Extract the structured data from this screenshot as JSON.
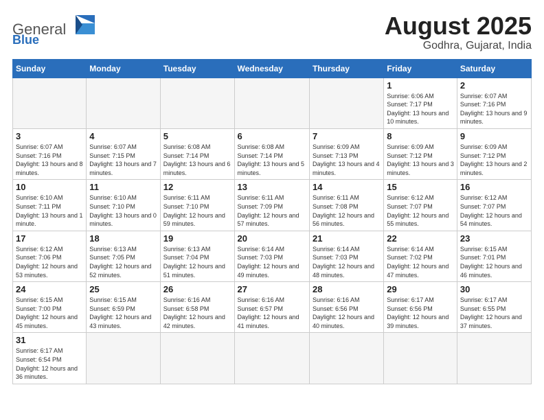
{
  "header": {
    "logo_text_general": "General",
    "logo_text_blue": "Blue",
    "month_year": "August 2025",
    "location": "Godhra, Gujarat, India"
  },
  "weekdays": [
    "Sunday",
    "Monday",
    "Tuesday",
    "Wednesday",
    "Thursday",
    "Friday",
    "Saturday"
  ],
  "weeks": [
    [
      {
        "day": "",
        "info": ""
      },
      {
        "day": "",
        "info": ""
      },
      {
        "day": "",
        "info": ""
      },
      {
        "day": "",
        "info": ""
      },
      {
        "day": "",
        "info": ""
      },
      {
        "day": "1",
        "info": "Sunrise: 6:06 AM\nSunset: 7:17 PM\nDaylight: 13 hours\nand 10 minutes."
      },
      {
        "day": "2",
        "info": "Sunrise: 6:07 AM\nSunset: 7:16 PM\nDaylight: 13 hours\nand 9 minutes."
      }
    ],
    [
      {
        "day": "3",
        "info": "Sunrise: 6:07 AM\nSunset: 7:16 PM\nDaylight: 13 hours\nand 8 minutes."
      },
      {
        "day": "4",
        "info": "Sunrise: 6:07 AM\nSunset: 7:15 PM\nDaylight: 13 hours\nand 7 minutes."
      },
      {
        "day": "5",
        "info": "Sunrise: 6:08 AM\nSunset: 7:14 PM\nDaylight: 13 hours\nand 6 minutes."
      },
      {
        "day": "6",
        "info": "Sunrise: 6:08 AM\nSunset: 7:14 PM\nDaylight: 13 hours\nand 5 minutes."
      },
      {
        "day": "7",
        "info": "Sunrise: 6:09 AM\nSunset: 7:13 PM\nDaylight: 13 hours\nand 4 minutes."
      },
      {
        "day": "8",
        "info": "Sunrise: 6:09 AM\nSunset: 7:12 PM\nDaylight: 13 hours\nand 3 minutes."
      },
      {
        "day": "9",
        "info": "Sunrise: 6:09 AM\nSunset: 7:12 PM\nDaylight: 13 hours\nand 2 minutes."
      }
    ],
    [
      {
        "day": "10",
        "info": "Sunrise: 6:10 AM\nSunset: 7:11 PM\nDaylight: 13 hours\nand 1 minute."
      },
      {
        "day": "11",
        "info": "Sunrise: 6:10 AM\nSunset: 7:10 PM\nDaylight: 13 hours\nand 0 minutes."
      },
      {
        "day": "12",
        "info": "Sunrise: 6:11 AM\nSunset: 7:10 PM\nDaylight: 12 hours\nand 59 minutes."
      },
      {
        "day": "13",
        "info": "Sunrise: 6:11 AM\nSunset: 7:09 PM\nDaylight: 12 hours\nand 57 minutes."
      },
      {
        "day": "14",
        "info": "Sunrise: 6:11 AM\nSunset: 7:08 PM\nDaylight: 12 hours\nand 56 minutes."
      },
      {
        "day": "15",
        "info": "Sunrise: 6:12 AM\nSunset: 7:07 PM\nDaylight: 12 hours\nand 55 minutes."
      },
      {
        "day": "16",
        "info": "Sunrise: 6:12 AM\nSunset: 7:07 PM\nDaylight: 12 hours\nand 54 minutes."
      }
    ],
    [
      {
        "day": "17",
        "info": "Sunrise: 6:12 AM\nSunset: 7:06 PM\nDaylight: 12 hours\nand 53 minutes."
      },
      {
        "day": "18",
        "info": "Sunrise: 6:13 AM\nSunset: 7:05 PM\nDaylight: 12 hours\nand 52 minutes."
      },
      {
        "day": "19",
        "info": "Sunrise: 6:13 AM\nSunset: 7:04 PM\nDaylight: 12 hours\nand 51 minutes."
      },
      {
        "day": "20",
        "info": "Sunrise: 6:14 AM\nSunset: 7:03 PM\nDaylight: 12 hours\nand 49 minutes."
      },
      {
        "day": "21",
        "info": "Sunrise: 6:14 AM\nSunset: 7:03 PM\nDaylight: 12 hours\nand 48 minutes."
      },
      {
        "day": "22",
        "info": "Sunrise: 6:14 AM\nSunset: 7:02 PM\nDaylight: 12 hours\nand 47 minutes."
      },
      {
        "day": "23",
        "info": "Sunrise: 6:15 AM\nSunset: 7:01 PM\nDaylight: 12 hours\nand 46 minutes."
      }
    ],
    [
      {
        "day": "24",
        "info": "Sunrise: 6:15 AM\nSunset: 7:00 PM\nDaylight: 12 hours\nand 45 minutes."
      },
      {
        "day": "25",
        "info": "Sunrise: 6:15 AM\nSunset: 6:59 PM\nDaylight: 12 hours\nand 43 minutes."
      },
      {
        "day": "26",
        "info": "Sunrise: 6:16 AM\nSunset: 6:58 PM\nDaylight: 12 hours\nand 42 minutes."
      },
      {
        "day": "27",
        "info": "Sunrise: 6:16 AM\nSunset: 6:57 PM\nDaylight: 12 hours\nand 41 minutes."
      },
      {
        "day": "28",
        "info": "Sunrise: 6:16 AM\nSunset: 6:56 PM\nDaylight: 12 hours\nand 40 minutes."
      },
      {
        "day": "29",
        "info": "Sunrise: 6:17 AM\nSunset: 6:56 PM\nDaylight: 12 hours\nand 39 minutes."
      },
      {
        "day": "30",
        "info": "Sunrise: 6:17 AM\nSunset: 6:55 PM\nDaylight: 12 hours\nand 37 minutes."
      }
    ],
    [
      {
        "day": "31",
        "info": "Sunrise: 6:17 AM\nSunset: 6:54 PM\nDaylight: 12 hours\nand 36 minutes."
      },
      {
        "day": "",
        "info": ""
      },
      {
        "day": "",
        "info": ""
      },
      {
        "day": "",
        "info": ""
      },
      {
        "day": "",
        "info": ""
      },
      {
        "day": "",
        "info": ""
      },
      {
        "day": "",
        "info": ""
      }
    ]
  ]
}
